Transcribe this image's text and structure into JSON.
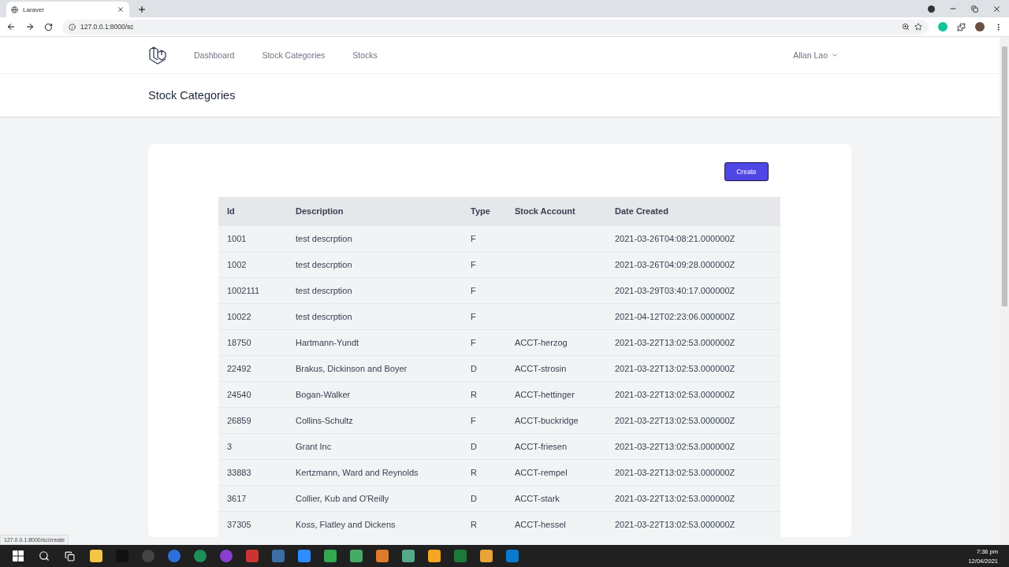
{
  "browser": {
    "tab_title": "Laravel",
    "url": "127.0.0.1:8000/sc",
    "status_url": "127.0.0.1:8000/sc/create"
  },
  "nav": {
    "links": [
      "Dashboard",
      "Stock Categories",
      "Stocks"
    ],
    "user": "Allan Lao"
  },
  "page_title": "Stock Categories",
  "create_button": "Create",
  "table": {
    "columns": [
      "Id",
      "Description",
      "Type",
      "Stock Account",
      "Date Created"
    ],
    "rows": [
      [
        "1001",
        "test descrption",
        "F",
        "",
        "2021-03-26T04:08:21.000000Z"
      ],
      [
        "1002",
        "test descrption",
        "F",
        "",
        "2021-03-26T04:09:28.000000Z"
      ],
      [
        "1002111",
        "test descrption",
        "F",
        "",
        "2021-03-29T03:40:17.000000Z"
      ],
      [
        "10022",
        "test descrption",
        "F",
        "",
        "2021-04-12T02:23:06.000000Z"
      ],
      [
        "18750",
        "Hartmann-Yundt",
        "F",
        "ACCT-herzog",
        "2021-03-22T13:02:53.000000Z"
      ],
      [
        "22492",
        "Brakus, Dickinson and Boyer",
        "D",
        "ACCT-strosin",
        "2021-03-22T13:02:53.000000Z"
      ],
      [
        "24540",
        "Bogan-Walker",
        "R",
        "ACCT-hettinger",
        "2021-03-22T13:02:53.000000Z"
      ],
      [
        "26859",
        "Collins-Schultz",
        "F",
        "ACCT-buckridge",
        "2021-03-22T13:02:53.000000Z"
      ],
      [
        "3",
        "Grant Inc",
        "D",
        "ACCT-friesen",
        "2021-03-22T13:02:53.000000Z"
      ],
      [
        "33883",
        "Kertzmann, Ward and Reynolds",
        "R",
        "ACCT-rempel",
        "2021-03-22T13:02:53.000000Z"
      ],
      [
        "3617",
        "Collier, Kub and O'Reilly",
        "D",
        "ACCT-stark",
        "2021-03-22T13:02:53.000000Z"
      ],
      [
        "37305",
        "Koss, Flatley and Dickens",
        "R",
        "ACCT-hessel",
        "2021-03-22T13:02:53.000000Z"
      ]
    ]
  },
  "taskbar": {
    "time": "7:36 pm",
    "date": "12/04/2021"
  }
}
